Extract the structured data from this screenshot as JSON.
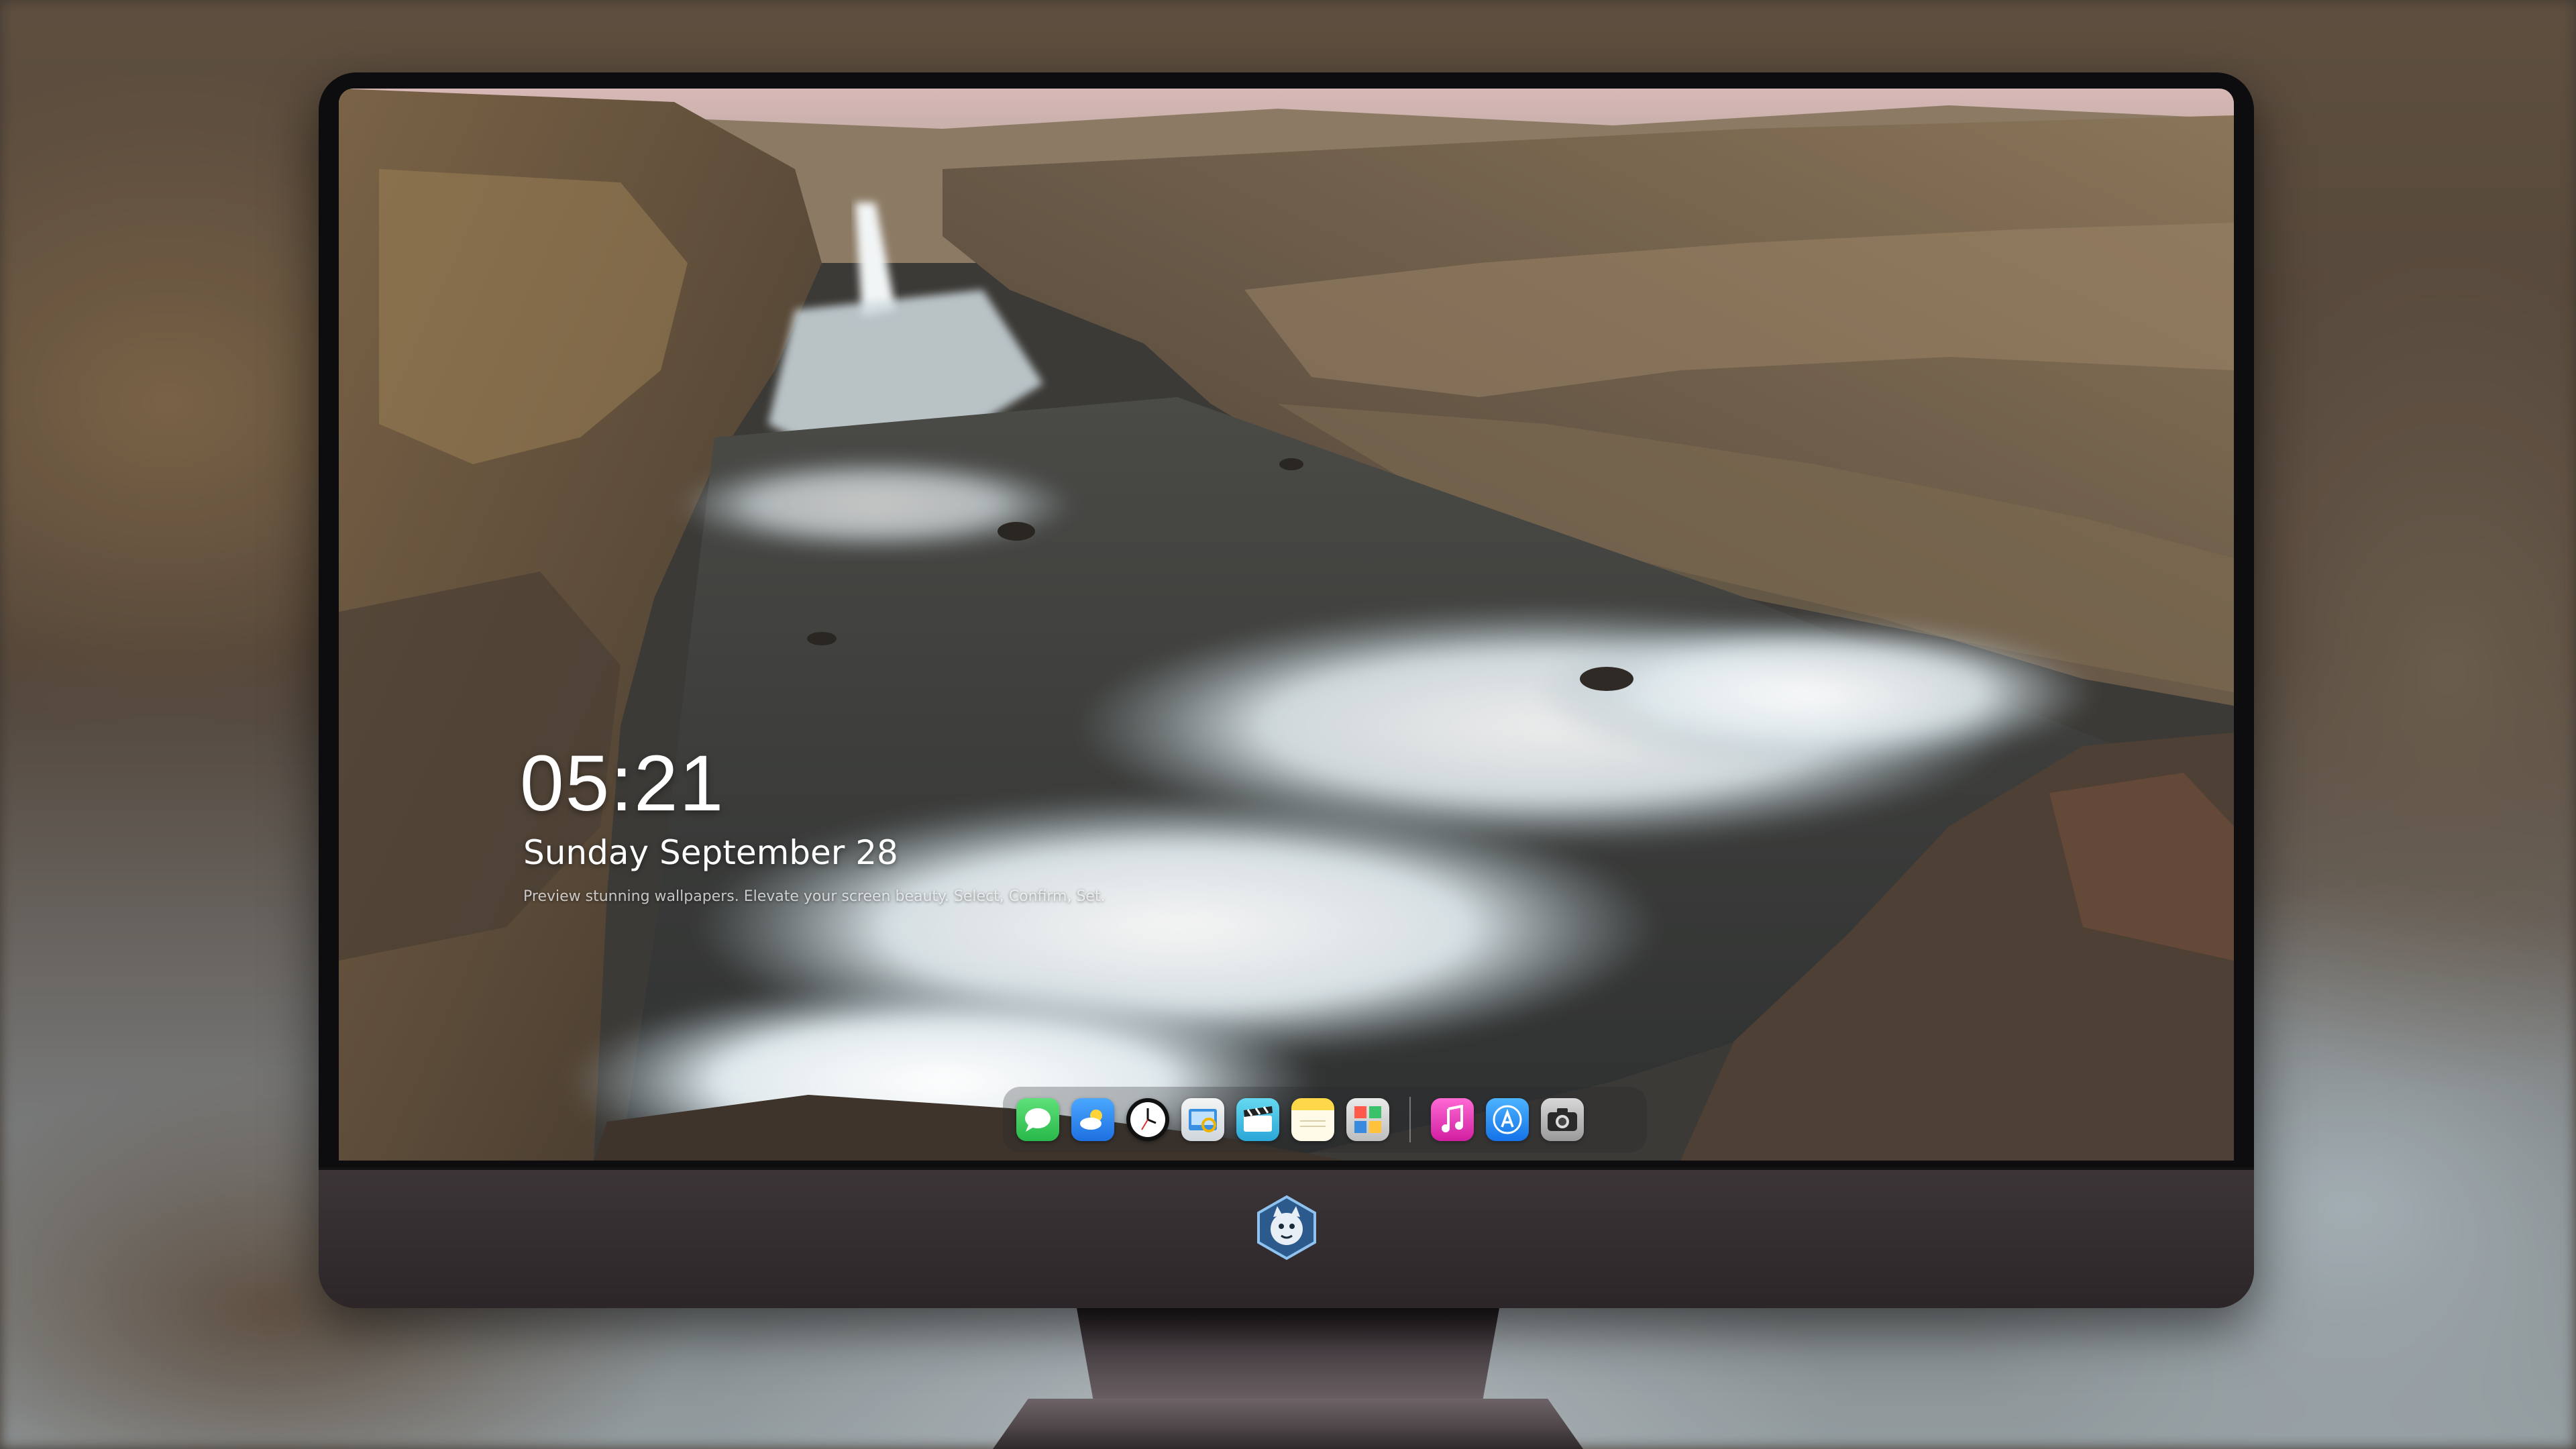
{
  "lock_screen": {
    "time": "05:21",
    "date": "Sunday September  28",
    "tagline": "Preview stunning wallpapers. Elevate your screen beauty. Select, Confirm, Set."
  },
  "dock": {
    "apps": [
      "messages",
      "weather",
      "clock",
      "preview",
      "clips",
      "notes",
      "photo-booth"
    ],
    "pinned": [
      "music",
      "app-store",
      "camera"
    ]
  },
  "colors": {
    "messages": "#34c759",
    "weather": "#2f8cff",
    "music": "#ff3fbf",
    "app_store": "#1a8cff",
    "monitor_chin": "#2c2629"
  }
}
